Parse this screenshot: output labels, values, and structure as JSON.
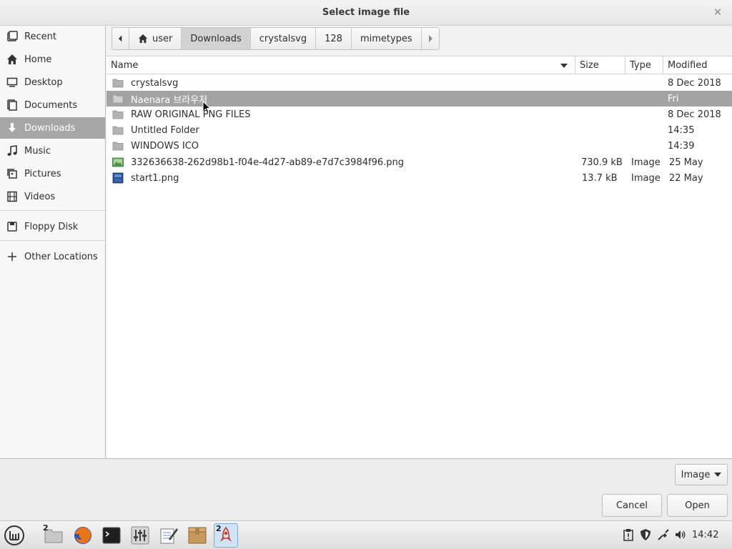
{
  "window": {
    "title": "Select image file"
  },
  "sidebar": {
    "items": [
      {
        "label": "Recent",
        "icon": "recent-icon"
      },
      {
        "label": "Home",
        "icon": "home-icon"
      },
      {
        "label": "Desktop",
        "icon": "desktop-icon"
      },
      {
        "label": "Documents",
        "icon": "documents-icon"
      },
      {
        "label": "Downloads",
        "icon": "downloads-icon",
        "active": true
      },
      {
        "label": "Music",
        "icon": "music-icon"
      },
      {
        "label": "Pictures",
        "icon": "pictures-icon"
      },
      {
        "label": "Videos",
        "icon": "videos-icon"
      },
      {
        "label": "Floppy Disk",
        "icon": "floppy-icon"
      },
      {
        "label": "Other Locations",
        "icon": "plus-icon"
      }
    ]
  },
  "pathbar": {
    "crumbs": [
      "user",
      "Downloads",
      "crystalsvg",
      "128",
      "mimetypes"
    ],
    "active": "Downloads"
  },
  "columns": {
    "name": "Name",
    "size": "Size",
    "type": "Type",
    "modified": "Modified"
  },
  "files": [
    {
      "name": "crystalsvg",
      "size": "",
      "type": "",
      "modified": "8 Dec 2018",
      "kind": "folder"
    },
    {
      "name": "Naenara 브라우저",
      "size": "",
      "type": "",
      "modified": "Fri",
      "kind": "folder",
      "selected": true
    },
    {
      "name": "RAW ORIGINAL PNG FILES",
      "size": "",
      "type": "",
      "modified": "8 Dec 2018",
      "kind": "folder"
    },
    {
      "name": "Untitled Folder",
      "size": "",
      "type": "",
      "modified": "14:35",
      "kind": "folder"
    },
    {
      "name": "WINDOWS ICO",
      "size": "",
      "type": "",
      "modified": "14:39",
      "kind": "folder"
    },
    {
      "name": "332636638-262d98b1-f04e-4d27-ab89-e7d7c3984f96.png",
      "size": "730.9 kB",
      "type": "Image",
      "modified": "25 May",
      "kind": "image"
    },
    {
      "name": "start1.png",
      "size": "13.7 kB",
      "type": "Image",
      "modified": "22 May",
      "kind": "image2"
    }
  ],
  "filter": {
    "label": "Image"
  },
  "buttons": {
    "cancel": "Cancel",
    "open": "Open"
  },
  "taskbar": {
    "badges": {
      "files": "2",
      "app": "2"
    },
    "clock": "14:42"
  }
}
